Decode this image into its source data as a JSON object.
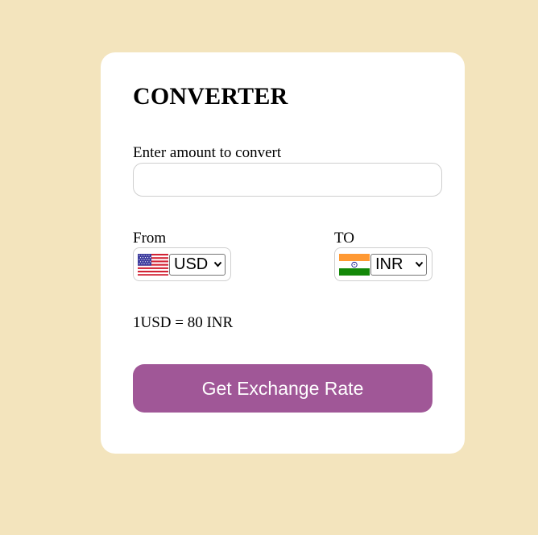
{
  "converter": {
    "title": "CONVERTER",
    "amount_label": "Enter amount to convert",
    "amount_value": "",
    "amount_placeholder": "",
    "from": {
      "label": "From",
      "currency": "USD",
      "flag_icon": "us-flag-icon"
    },
    "to": {
      "label": "TO",
      "currency": "INR",
      "flag_icon": "india-flag-icon"
    },
    "rate_text": "1USD = 80 INR",
    "button_label": "Get Exchange Rate"
  },
  "colors": {
    "page_background": "#f3e4bd",
    "card_background": "#ffffff",
    "button_background": "#a05797",
    "button_text": "#ffffff"
  }
}
